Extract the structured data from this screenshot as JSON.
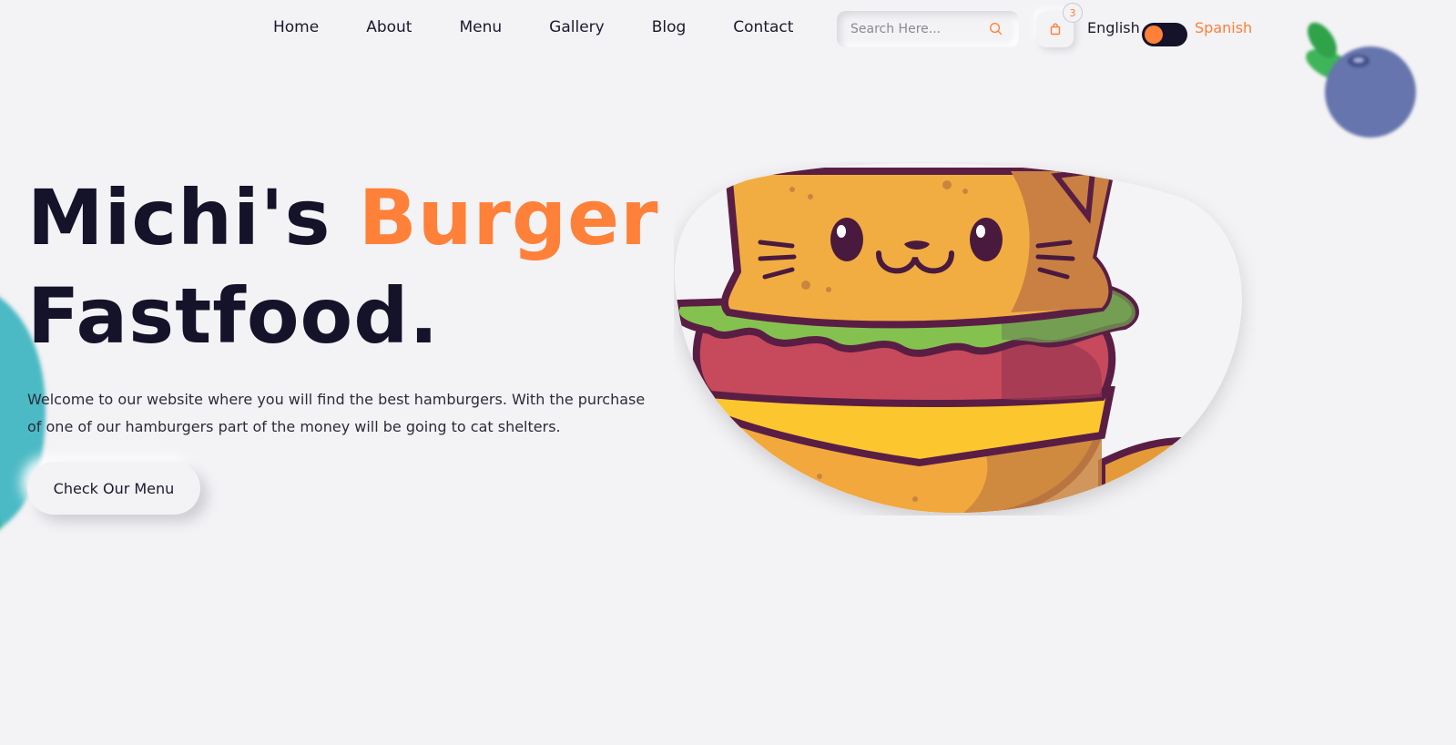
{
  "nav": {
    "links": [
      "Home",
      "About",
      "Menu",
      "Gallery",
      "Blog",
      "Contact"
    ],
    "search_placeholder": "Search Here...",
    "cart_count": "3",
    "lang_english": "English",
    "lang_spanish": "Spanish"
  },
  "hero": {
    "title_part1": "Michi's ",
    "title_accent": "Burger",
    "title_line2": "Fastfood.",
    "description": "Welcome to our website where you will find the best hamburgers. With the purchase of one of our hamburgers part of the money will be going to cat shelters.",
    "cta_label": "Check Our Menu"
  },
  "colors": {
    "accent": "#ff8038",
    "dark": "#14132a",
    "background": "#f3f2f5"
  },
  "icons": {
    "search": "search-icon",
    "cart": "shopping-bag-icon"
  }
}
